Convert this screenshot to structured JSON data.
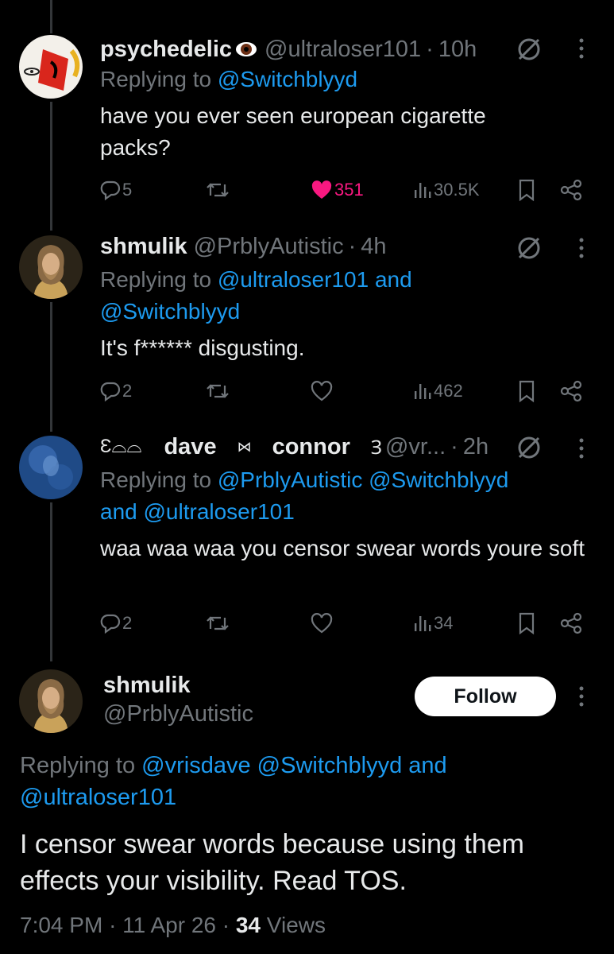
{
  "tweets": [
    {
      "display_name": "psychedelic",
      "name_emoji": "eye",
      "handle": "@ultraloser101",
      "dot": "·",
      "time": "10h",
      "replying_prefix": "Replying to",
      "replying_to": [
        "@Switchblyyd"
      ],
      "text": "have you ever seen european cigarette packs?",
      "replies": "5",
      "retweets": "",
      "likes": "351",
      "liked": true,
      "views": "30.5K"
    },
    {
      "display_name": "shmulik",
      "handle": "@PrblyAutistic",
      "dot": "·",
      "time": "4h",
      "replying_prefix": "Replying to",
      "replying_to": [
        "@ultraloser101",
        "and",
        "@Switchblyyd"
      ],
      "text": "It's f****** disgusting.",
      "replies": "2",
      "retweets": "",
      "likes": "",
      "liked": false,
      "views": "462"
    },
    {
      "display_name": "dave",
      "display_name_2": "connor",
      "handle": "@vr...",
      "dot": "·",
      "time": "2h",
      "replying_prefix": "Replying to",
      "replying_to": [
        "@PrblyAutistic",
        "@Switchblyyd",
        "and",
        "@ultraloser101"
      ],
      "text": "waa waa waa you censor swear words youre soft",
      "replies": "2",
      "retweets": "",
      "likes": "",
      "liked": false,
      "views": "34"
    }
  ],
  "main_tweet": {
    "display_name": "shmulik",
    "handle": "@PrblyAutistic",
    "follow_label": "Follow",
    "replying_prefix": "Replying to",
    "replying_to": [
      "@vrisdave",
      "@Switchblyyd",
      "and",
      "@ultraloser101"
    ],
    "text": "I censor swear words because using them effects your visibility. Read TOS.",
    "time": "7:04 PM",
    "date": "11 Apr 26",
    "views_count": "34",
    "views_label": "Views",
    "dot": "·"
  },
  "colors": {
    "background": "#000000",
    "text": "#e7e9ea",
    "muted": "#71767b",
    "link": "#1d9bf0",
    "like": "#f91880",
    "follow_bg": "#ffffff"
  },
  "icons": [
    "reply-icon",
    "retweet-icon",
    "heart-icon",
    "views-icon",
    "bookmark-icon",
    "share-icon",
    "grok-mute-icon",
    "more-icon"
  ]
}
